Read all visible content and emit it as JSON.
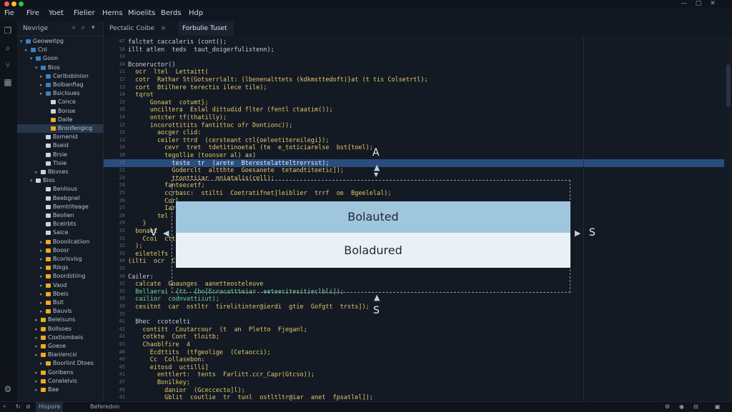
{
  "menu": [
    "Fie",
    "Fire",
    "Yoet",
    "Fielier",
    "Hems",
    "Mioelits",
    "Berds",
    "Hdp"
  ],
  "sidebar": {
    "title": "Nevrige",
    "controls": [
      "◃",
      "⌕",
      "▾"
    ],
    "tree": [
      {
        "label": "Geoweitpg",
        "indent": 0,
        "color": "#3b82c4",
        "caret": "▾",
        "sel": false
      },
      {
        "label": "Cnl",
        "indent": 1,
        "color": "#3b82c4",
        "caret": "▸",
        "sel": false
      },
      {
        "label": "Goon",
        "indent": 2,
        "color": "#3b82c4",
        "caret": "▾",
        "sel": false
      },
      {
        "label": "Bios",
        "indent": 3,
        "color": "#3b82c4",
        "caret": "▾",
        "sel": false
      },
      {
        "label": "Ceribsbinion",
        "indent": 4,
        "color": "#3b82c4",
        "caret": "▸",
        "sel": false
      },
      {
        "label": "Bolbanfiag",
        "indent": 4,
        "color": "#3b82c4",
        "caret": "▸",
        "sel": false
      },
      {
        "label": "Bsicloues",
        "indent": 4,
        "color": "#3b82c4",
        "caret": "▸",
        "sel": false
      },
      {
        "label": "Conce",
        "indent": 5,
        "color": "#cbd5e1",
        "caret": "",
        "sel": false
      },
      {
        "label": "Bonse",
        "indent": 5,
        "color": "#cbd5e1",
        "caret": "",
        "sel": false
      },
      {
        "label": "Dalle",
        "indent": 5,
        "color": "#f2a91d",
        "caret": "",
        "sel": false
      },
      {
        "label": "Bronfengicg",
        "indent": 5,
        "color": "#f2a91d",
        "caret": "",
        "sel": true
      },
      {
        "label": "Bsmenid",
        "indent": 4,
        "color": "#cbd5e1",
        "caret": "",
        "sel": false
      },
      {
        "label": "Bseid",
        "indent": 4,
        "color": "#cbd5e1",
        "caret": "",
        "sel": false
      },
      {
        "label": "Brsie",
        "indent": 4,
        "color": "#cbd5e1",
        "caret": "",
        "sel": false
      },
      {
        "label": "Tloie",
        "indent": 4,
        "color": "#cbd5e1",
        "caret": "",
        "sel": false
      },
      {
        "label": "Bbvses",
        "indent": 3,
        "color": "#cbd5e1",
        "caret": "▸",
        "sel": false
      },
      {
        "label": "Bios",
        "indent": 2,
        "color": "#cbd5e1",
        "caret": "▾",
        "sel": false
      },
      {
        "label": "Benlious",
        "indent": 4,
        "color": "#cbd5e1",
        "caret": "",
        "sel": false
      },
      {
        "label": "Beebgnel",
        "indent": 4,
        "color": "#cbd5e1",
        "caret": "",
        "sel": false
      },
      {
        "label": "Bemtriteage",
        "indent": 4,
        "color": "#cbd5e1",
        "caret": "",
        "sel": false
      },
      {
        "label": "Beolien",
        "indent": 4,
        "color": "#cbd5e1",
        "caret": "",
        "sel": false
      },
      {
        "label": "Bcelrbts",
        "indent": 4,
        "color": "#cbd5e1",
        "caret": "",
        "sel": false
      },
      {
        "label": "Salce",
        "indent": 4,
        "color": "#cbd5e1",
        "caret": "",
        "sel": false
      },
      {
        "label": "Boooilcatiion",
        "indent": 4,
        "color": "#f2a91d",
        "caret": "▸",
        "sel": false
      },
      {
        "label": "Boosr",
        "indent": 4,
        "color": "#f2a91d",
        "caret": "▸",
        "sel": false
      },
      {
        "label": "Bcorisvisg",
        "indent": 4,
        "color": "#f2a91d",
        "caret": "▸",
        "sel": false
      },
      {
        "label": "Rikgs",
        "indent": 4,
        "color": "#f2a91d",
        "caret": "▸",
        "sel": false
      },
      {
        "label": "Boordstiing",
        "indent": 4,
        "color": "#f2a91d",
        "caret": "▸",
        "sel": false
      },
      {
        "label": "Vaod",
        "indent": 4,
        "color": "#f2a91d",
        "caret": "▸",
        "sel": false
      },
      {
        "label": "Bbeis",
        "indent": 4,
        "color": "#f2a91d",
        "caret": "▸",
        "sel": false
      },
      {
        "label": "Bsit",
        "indent": 4,
        "color": "#f2a91d",
        "caret": "▸",
        "sel": false
      },
      {
        "label": "Bauvis",
        "indent": 4,
        "color": "#f2a91d",
        "caret": "▸",
        "sel": false
      },
      {
        "label": "Beleisuns",
        "indent": 3,
        "color": "#f2a91d",
        "caret": "▸",
        "sel": false
      },
      {
        "label": "Bollsoes",
        "indent": 3,
        "color": "#f2a91d",
        "caret": "▸",
        "sel": false
      },
      {
        "label": "Coxtiombeis",
        "indent": 3,
        "color": "#f2a91d",
        "caret": "▸",
        "sel": false
      },
      {
        "label": "Goese",
        "indent": 3,
        "color": "#f2a91d",
        "caret": "▸",
        "sel": false
      },
      {
        "label": "Bianlencsi",
        "indent": 3,
        "color": "#f2a91d",
        "caret": "▸",
        "sel": false
      },
      {
        "label": "Boorlint Dtoes",
        "indent": 4,
        "color": "#f2a91d",
        "caret": "▸",
        "sel": false
      },
      {
        "label": "Goribens",
        "indent": 3,
        "color": "#f2a91d",
        "caret": "▸",
        "sel": false
      },
      {
        "label": "Conelelvis",
        "indent": 3,
        "color": "#f2a91d",
        "caret": "▸",
        "sel": false
      },
      {
        "label": "Bae",
        "indent": 3,
        "color": "#f2a91d",
        "caret": "▸",
        "sel": false
      }
    ]
  },
  "tabs": [
    {
      "label": "Pectalic Coibe",
      "close": "×",
      "active": false
    },
    {
      "label": "Forbulie Tuset",
      "close": "",
      "active": true
    }
  ],
  "gutter": [
    "47",
    "16",
    "14",
    "34",
    "11",
    "12",
    "13",
    "14",
    "15",
    "16",
    "14",
    "12",
    "13",
    "13",
    "16",
    "18",
    "18",
    "21",
    "23",
    "24",
    "25",
    "26",
    "27",
    "28",
    "29",
    "31",
    "31",
    "32",
    "33",
    "34",
    "35",
    "36",
    "32",
    "35",
    "39",
    "39",
    "35",
    "41",
    "41",
    "41",
    "45",
    "46",
    "49",
    "45",
    "41",
    "47",
    "49",
    "41"
  ],
  "code": [
    {
      "text": "falctet caccaleris (cont();",
      "color": "#c8cdd6",
      "indent": 0
    },
    {
      "text": "illt atlen  teds  taut_doigerfulistenn);",
      "color": "#c8cdd6",
      "indent": 0
    },
    {
      "text": "",
      "color": "#c8cdd6",
      "indent": 0
    },
    {
      "text": "Bconeructor()",
      "color": "#c8cdd6",
      "indent": 0
    },
    {
      "text": "  ocr  ltel  Lettaitt(",
      "color": "#e4c86a",
      "indent": 0
    },
    {
      "text": "  cotr  Rathar St(Gotserrlalt: (lbenenalttets (kdkmsttedoft)}at (t tis Colsetrtl);",
      "color": "#e4c86a",
      "indent": 0
    },
    {
      "text": "  cort  Btilhere terectis ilece tile);",
      "color": "#e4c86a",
      "indent": 0
    },
    {
      "text": "  tqrot",
      "color": "#e4c86a",
      "indent": 0
    },
    {
      "text": "      Gonaat  cotumt};",
      "color": "#e4c86a",
      "indent": 0
    },
    {
      "text": "      unciltera  Eslal dittudid flter (fentl ctaatim());",
      "color": "#e4c86a",
      "indent": 0
    },
    {
      "text": "      ontcter tf(thatilly);",
      "color": "#e4c86a",
      "indent": 0
    },
    {
      "text": "      incorottitits fantittoc ofr Dontionc));",
      "color": "#e4c86a",
      "indent": 0
    },
    {
      "text": "        aocger clid:",
      "color": "#e4c86a",
      "indent": 0
    },
    {
      "text": "        ceiler ttrd  (cersteant ctl{oeleetitereilegi});",
      "color": "#e4c86a",
      "indent": 0
    },
    {
      "text": "          cevr  tret  tdetitinoetal (te  e_toticiarelse  bst{toel);",
      "color": "#e4c86a",
      "indent": 0
    },
    {
      "text": "          tegollie (toonser al) ax)",
      "color": "#e4c86a",
      "indent": 0
    },
    {
      "text": "            teste  tr  (arete  Bterestelatteltrerrsst);",
      "color": "#e6ecf3",
      "indent": 0
    },
    {
      "text": "            Goderclt  altthte  Goesanete  tetandtiteetic]);",
      "color": "#e4c86a",
      "indent": 0
    },
    {
      "text": "            ttonttiiar  nniatalis(cell);",
      "color": "#e4c86a",
      "indent": 0
    },
    {
      "text": "          fanteecetf;",
      "color": "#e4c86a",
      "indent": 0
    },
    {
      "text": "          ccrbasc:  stilti  Coetratifnet]leiblier  trrf  oe  Bgeelelal);",
      "color": "#e4c86a",
      "indent": 0
    },
    {
      "text": "          Corl",
      "color": "#e4c86a",
      "indent": 0
    },
    {
      "text": "          Iarnl",
      "color": "#e4c86a",
      "indent": 0
    },
    {
      "text": "        tel",
      "color": "#e4c86a",
      "indent": 0
    },
    {
      "text": "    }",
      "color": "#e4c86a",
      "indent": 0
    },
    {
      "text": "  bonaet",
      "color": "#e4c86a",
      "indent": 0
    },
    {
      "text": "    Ccoi  ctt",
      "color": "#e4c86a",
      "indent": 0
    },
    {
      "text": "  );",
      "color": "#e4c86a",
      "indent": 0
    },
    {
      "text": "  eiletelfs",
      "color": "#e4c86a",
      "indent": 0
    },
    {
      "text": "(ilti  ocr  Co",
      "color": "#e4c86a",
      "indent": 0
    },
    {
      "text": "",
      "color": "#c8cdd6",
      "indent": 0
    },
    {
      "text": "Cailer:",
      "color": "#c8cdd6",
      "indent": 0
    },
    {
      "text": "  calcate  Goaunges  aanetteosteleuve",
      "color": "#e4c86a",
      "indent": 0
    },
    {
      "text": "  Bellaerai  {tt  {bo[Ecracattteiar  eeteecitesitieclbli]);",
      "color": "#6fd49a",
      "indent": 0
    },
    {
      "text": "  cailior  codnvattiiut);",
      "color": "#6fd49a",
      "indent": 0
    },
    {
      "text": "  cesitnt  car  ostltr  tirelitinter@ierdi  gtie  Gofgtt  trsts]);",
      "color": "#e4c86a",
      "indent": 0
    },
    {
      "text": "",
      "color": "#c8cdd6",
      "indent": 0
    },
    {
      "text": "  Bhec  ccotcelti",
      "color": "#c8cdd6",
      "indent": 0
    },
    {
      "text": "    contitt  Coutarcour  (t  an  Pletto  Fjeganl;",
      "color": "#e4c86a",
      "indent": 0
    },
    {
      "text": "    cotkte  Cont  tloitb;",
      "color": "#e4c86a",
      "indent": 0
    },
    {
      "text": "    Chaoblfire  4",
      "color": "#e4c86a",
      "indent": 0
    },
    {
      "text": "      Ecdttits  (tfgeolige  (Cetaocci);",
      "color": "#e4c86a",
      "indent": 0
    },
    {
      "text": "      Cc  Collasebon:",
      "color": "#e4c86a",
      "indent": 0
    },
    {
      "text": "      eitosd  uctilli]",
      "color": "#e4c86a",
      "indent": 0
    },
    {
      "text": "        enttlert:  tents  Farlitt.ccr_Capr(Gtcso));",
      "color": "#e4c86a",
      "indent": 0
    },
    {
      "text": "        Bonilkey;",
      "color": "#e4c86a",
      "indent": 0
    },
    {
      "text": "          danior  (Gceccecto]l);",
      "color": "#e4c86a",
      "indent": 0
    },
    {
      "text": "          Gblit  coutlie  tr  tunl  ostltltr@iar  anet  fpsatlel]);",
      "color": "#e4c86a",
      "indent": 0
    }
  ],
  "popup": {
    "top_label": "Bolauted",
    "bottom_label": "Boladured",
    "top_color": "#9fc6dc",
    "bottom_color": "#e9f1f7"
  },
  "annotations": {
    "up_letter": "A",
    "left_letter": "V",
    "right_letter": "S",
    "bottom_letter": "S"
  },
  "status": {
    "left1": "Hispore",
    "left2": "Beferedon",
    "icons": [
      "⚙",
      "◉",
      "⊟",
      "▣"
    ]
  },
  "colors": {
    "accent_highlight": "#2a4d7e",
    "folder_orange": "#f2a91d",
    "folder_blue": "#3b82c4"
  }
}
